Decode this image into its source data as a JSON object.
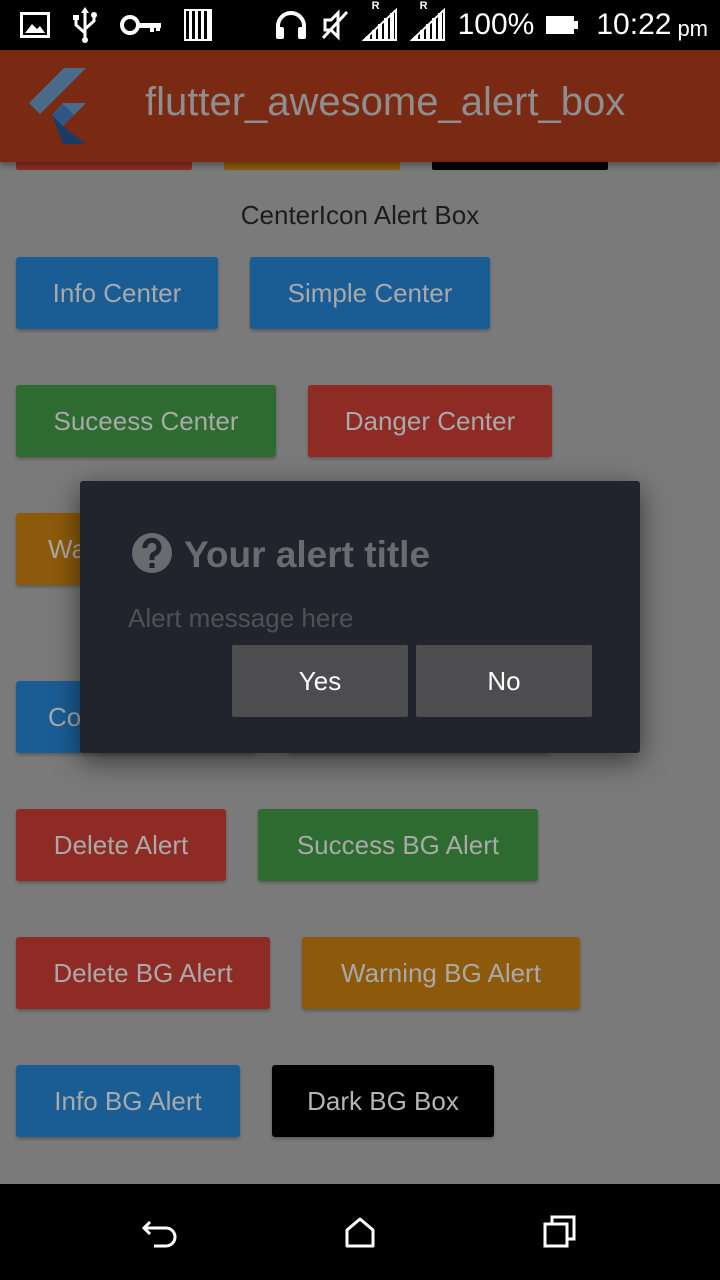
{
  "status_bar": {
    "battery_percent": "100%",
    "time": "10:22",
    "am_pm": "pm",
    "icons_left": [
      "image-icon",
      "usb-icon",
      "key-icon",
      "storage-icon"
    ],
    "icons_right": [
      "headset-icon",
      "mute-icon",
      "signal-r-icon",
      "signal-r-icon",
      "battery-icon"
    ],
    "roaming_mark": "R"
  },
  "app_bar": {
    "title": "flutter_awesome_alert_box",
    "color": "#7a2a12"
  },
  "section": {
    "title": "CenterIcon Alert Box"
  },
  "buttons": {
    "info_center": "Info Center",
    "simple_center": "Simple Center",
    "success_center": "Suceess Center",
    "danger_center": "Danger Center",
    "warning_partial": "Wa",
    "confirm_partial": "Co",
    "delete_alert": "Delete Alert",
    "success_bg_alert": "Success BG Alert",
    "delete_bg_alert": "Delete BG Alert",
    "warning_bg_alert": "Warning BG Alert",
    "info_bg_alert": "Info BG Alert",
    "dark_bg_box": "Dark BG Box"
  },
  "colors": {
    "info": "#1a5d94",
    "success": "#2e6b31",
    "danger": "#8f2b25",
    "warning": "#8c5a0a",
    "dark": "#000000",
    "overlay_bg": "#7a7a7a"
  },
  "dialog": {
    "icon": "question-circle-icon",
    "title": "Your alert title",
    "message": "Alert message here",
    "yes_label": "Yes",
    "no_label": "No",
    "yes_color": "#4d4d4f",
    "no_color": "#4d4d4f"
  },
  "nav_bar": {
    "icons": [
      "back-icon",
      "home-icon",
      "recents-icon"
    ]
  }
}
